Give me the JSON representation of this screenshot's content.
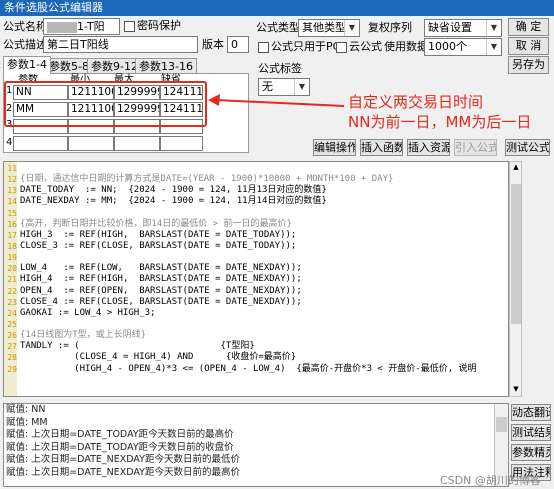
{
  "window": {
    "title": "条件选股公式编辑器"
  },
  "form": {
    "name_label": "公式名称",
    "name_value": "1-T阳",
    "password_label": "密码保护",
    "desc_label": "公式描述",
    "desc_value": "第二日T阳线",
    "version_label": "版本",
    "version_value": "0",
    "type_label": "公式类型",
    "type_value": "其他类型",
    "rights_label": "复权序列",
    "rights_value": "缺省设置",
    "pc_only_label": "公式只用于PC",
    "cloud_label": "云公式",
    "data_label": "使用数据",
    "data_value": "1000个",
    "tag_label": "公式标签",
    "tag_value": "无"
  },
  "buttons": {
    "ok": "确  定",
    "cancel": "取  消",
    "save_as": "另存为",
    "edit_ops": "编辑操作",
    "insert_func": "插入函数",
    "insert_res": "插入资源",
    "import": "引入公式",
    "test": "测试公式",
    "dyn_translate": "动态翻译",
    "test_result": "测试结果",
    "param_wizard": "参数精灵",
    "usage_note": "用法注释"
  },
  "tabs": [
    "参数1-4",
    "参数5-8",
    "参数9-12",
    "参数13-16"
  ],
  "params": {
    "headers": [
      "参数",
      "最小",
      "最大",
      "缺省"
    ],
    "rows": [
      {
        "num": "1",
        "name": "NN",
        "min": "1211100",
        "max": "1299999",
        "def": "1241113"
      },
      {
        "num": "2",
        "name": "MM",
        "min": "1211100",
        "max": "1299999",
        "def": "1241114"
      },
      {
        "num": "3",
        "name": "",
        "min": "",
        "max": "",
        "def": ""
      },
      {
        "num": "4",
        "name": "",
        "min": "",
        "max": "",
        "def": ""
      }
    ]
  },
  "annotation": {
    "line1": "自定义两交易日时间",
    "line2": "NN为前一日，MM为后一日"
  },
  "code": [
    {
      "n": "11",
      "t": "",
      "c": "#000"
    },
    {
      "n": "12",
      "t": "{日期，通达信中日期的计算方式是DATE=(YEAR - 1900)*10000 + MONTH*100 + DAY}",
      "c": "#8a8a8a"
    },
    {
      "n": "13",
      "t": "DATE_TODAY  := NN;  {2024 - 1900 = 124, 11月13日对应的数值}",
      "c": "#000"
    },
    {
      "n": "14",
      "t": "DATE_NEXDAY := MM;  {2024 - 1900 = 124, 11月14日对应的数值}",
      "c": "#000"
    },
    {
      "n": "15",
      "t": "",
      "c": "#000"
    },
    {
      "n": "16",
      "t": "{高开，判断日期并比较价格，即14日的最低价 > 前一日的最高价}",
      "c": "#8a8a8a"
    },
    {
      "n": "17",
      "t": "HIGH_3  := REF(HIGH,  BARSLAST(DATE = DATE_TODAY));",
      "c": "#000"
    },
    {
      "n": "18",
      "t": "CLOSE_3 := REF(CLOSE, BARSLAST(DATE = DATE_TODAY));",
      "c": "#000"
    },
    {
      "n": "19",
      "t": "",
      "c": "#000"
    },
    {
      "n": "20",
      "t": "LOW_4   := REF(LOW,   BARSLAST(DATE = DATE_NEXDAY));",
      "c": "#000"
    },
    {
      "n": "21",
      "t": "HIGH_4  := REF(HIGH,  BARSLAST(DATE = DATE_NEXDAY));",
      "c": "#000"
    },
    {
      "n": "22",
      "t": "OPEN_4  := REF(OPEN,  BARSLAST(DATE = DATE_NEXDAY));",
      "c": "#000"
    },
    {
      "n": "23",
      "t": "CLOSE_4 := REF(CLOSE, BARSLAST(DATE = DATE_NEXDAY));",
      "c": "#000"
    },
    {
      "n": "24",
      "t": "GAOKAI := LOW_4 > HIGH_3;",
      "c": "#000"
    },
    {
      "n": "25",
      "t": "",
      "c": "#000"
    },
    {
      "n": "26",
      "t": "{14日线图为T型，或上长阴线}",
      "c": "#8a8a8a"
    },
    {
      "n": "27",
      "t": "TANDLY := (                          {T型阳}",
      "c": "#000"
    },
    {
      "n": "28",
      "t": "          (CLOSE_4 = HIGH_4) AND      {收盘价=最高价}",
      "c": "#000"
    },
    {
      "n": "29",
      "t": "          (HIGH_4 - OPEN_4)*3 <= (OPEN_4 - LOW_4)  {最高价-开盘价*3 < 开盘价-最低价, 说明",
      "c": "#000"
    }
  ],
  "output": [
    "赋值: NN",
    "赋值: MM",
    "赋值: 上次日期=DATE_TODAY距今天数日前的最高价",
    "赋值: 上次日期=DATE_TODAY距今天数日前的收盘价",
    "赋值: 上次日期=DATE_NEXDAY距今天数日前的最低价",
    "赋值: 上次日期=DATE_NEXDAY距今天数日前的最高价"
  ],
  "watermark": "CSDN @胡川的博客",
  "colors": {
    "annotation": "#e32a1c",
    "titlebar": "#1d67b8",
    "keyword": "#0000ff",
    "comment": "#8a8a8a"
  }
}
